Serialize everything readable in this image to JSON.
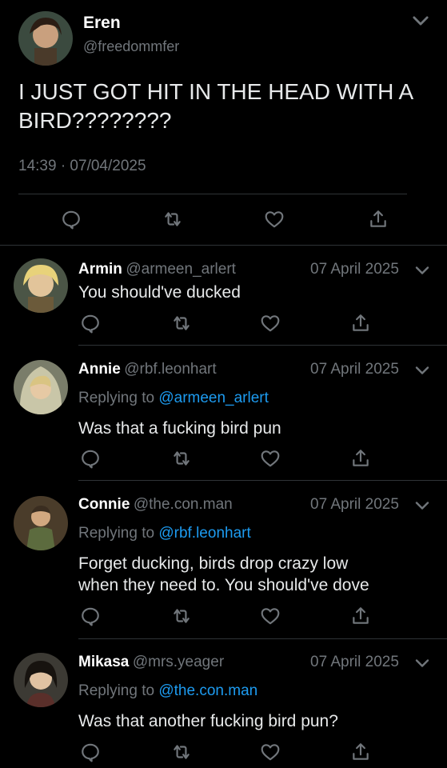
{
  "main_tweet": {
    "name": "Eren",
    "handle": "@freedommfer",
    "text_line1": "I JUST GOT HIT IN THE HEAD WITH A",
    "text_line2": "BIRD????????",
    "timestamp": "14:39 · 07/04/2025"
  },
  "replies": [
    {
      "name": "Armin",
      "handle": "@armeen_arlert",
      "date": "07 April 2025",
      "replying_label": "",
      "replying_to": "",
      "text_line1": "You should've ducked",
      "text_line2": ""
    },
    {
      "name": "Annie",
      "handle": "@rbf.leonhart",
      "date": "07 April 2025",
      "replying_label": "Replying to",
      "replying_to": "@armeen_arlert",
      "text_line1": "Was that a fucking bird pun",
      "text_line2": ""
    },
    {
      "name": "Connie",
      "handle": "@the.con.man",
      "date": "07 April 2025",
      "replying_label": "Replying to",
      "replying_to": "@rbf.leonhart",
      "text_line1": "Forget ducking, birds drop crazy low",
      "text_line2": "when they need to. You should've dove"
    },
    {
      "name": "Mikasa",
      "handle": "@mrs.yeager",
      "date": "07 April 2025",
      "replying_label": "Replying to",
      "replying_to": "@the.con.man",
      "text_line1": "Was that another fucking bird pun?",
      "text_line2": ""
    }
  ],
  "icons": [
    "reply-icon",
    "retweet-icon",
    "like-icon",
    "share-icon",
    "chevron-down-icon"
  ],
  "colors": {
    "background": "#000000",
    "text": "#e7e9ea",
    "muted": "#71767b",
    "link": "#1d9bf0",
    "divider": "#2f3336"
  }
}
